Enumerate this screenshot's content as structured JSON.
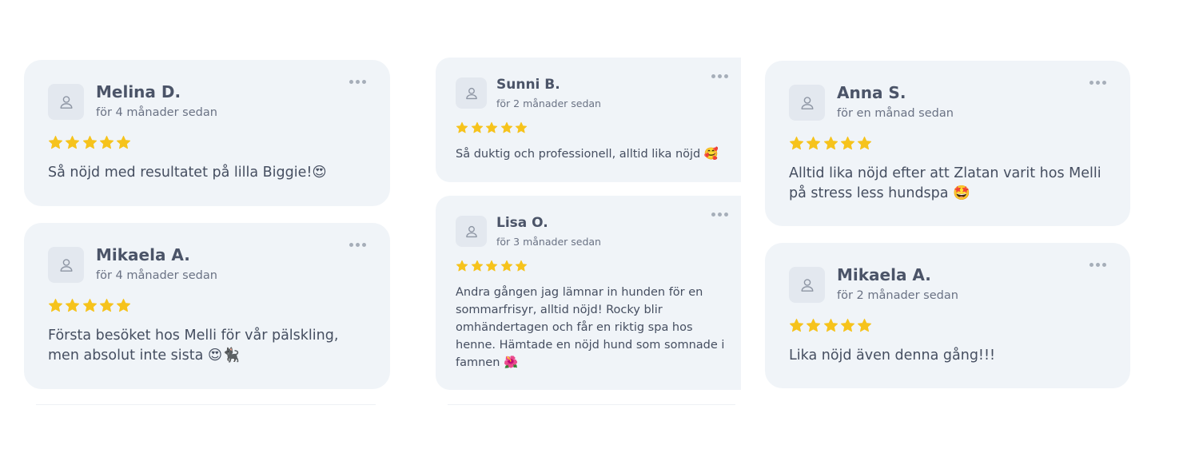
{
  "reviews": [
    {
      "name": "Melina D.",
      "date": "för 4 månader sedan",
      "rating": 5,
      "text": "Så nöjd med resultatet på lilla Biggie!😍"
    },
    {
      "name": "Mikaela A.",
      "date": "för 4 månader sedan",
      "rating": 5,
      "text": "Första besöket hos Melli  för vår pälskling, men absolut inte sista 😍🐈‍⬛"
    },
    {
      "name": "Sunni B.",
      "date": "för 2 månader sedan",
      "rating": 5,
      "text": "Så duktig och professionell, alltid lika nöjd 🥰"
    },
    {
      "name": "Lisa O.",
      "date": "för 3 månader sedan",
      "rating": 5,
      "text": "Andra gången jag lämnar in hunden för en sommarfrisyr, alltid nöjd! Rocky blir omhändertagen och får en riktig spa hos henne. Hämtade en nöjd hund som somnade i famnen 🌺"
    },
    {
      "name": "Anna S.",
      "date": "för en månad sedan",
      "rating": 5,
      "text": "Alltid lika nöjd efter att Zlatan varit hos Melli på stress less hundspa 🤩"
    },
    {
      "name": "Mikaela A.",
      "date": "för 2 månader sedan",
      "rating": 5,
      "text": "Lika nöjd även denna gång!!!"
    }
  ],
  "icons": {
    "avatar": "user-outline-icon",
    "menu": "more-horizontal-icon",
    "star": "star-filled-icon"
  },
  "colors": {
    "card_bg": "#f0f4f8",
    "star": "#f6c31c",
    "name": "#4b5468",
    "text": "#454e60"
  }
}
